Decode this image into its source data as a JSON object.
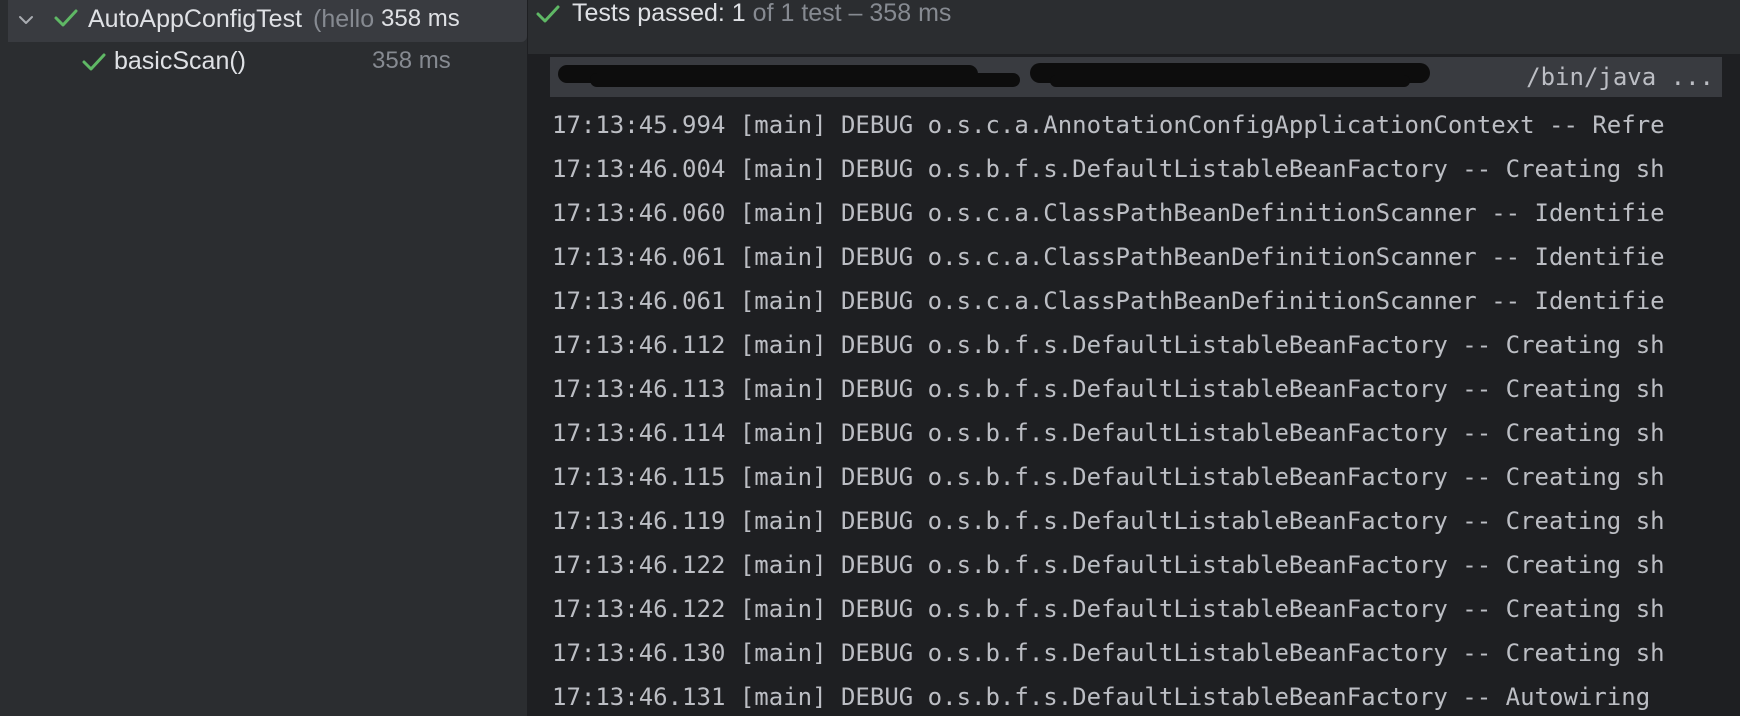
{
  "tree": {
    "root": {
      "label": "AutoAppConfigTest",
      "hint": "(hello",
      "time": "358 ms"
    },
    "child": {
      "label": "basicScan()",
      "time": "358 ms"
    }
  },
  "status": {
    "passed_label": "Tests passed: 1",
    "detail": "of 1 test – 358 ms"
  },
  "command": {
    "visible_text": "/bin/java ..."
  },
  "log": [
    "17:13:45.994 [main] DEBUG o.s.c.a.AnnotationConfigApplicationContext -- Refre",
    "17:13:46.004 [main] DEBUG o.s.b.f.s.DefaultListableBeanFactory -- Creating sh",
    "17:13:46.060 [main] DEBUG o.s.c.a.ClassPathBeanDefinitionScanner -- Identifie",
    "17:13:46.061 [main] DEBUG o.s.c.a.ClassPathBeanDefinitionScanner -- Identifie",
    "17:13:46.061 [main] DEBUG o.s.c.a.ClassPathBeanDefinitionScanner -- Identifie",
    "17:13:46.112 [main] DEBUG o.s.b.f.s.DefaultListableBeanFactory -- Creating sh",
    "17:13:46.113 [main] DEBUG o.s.b.f.s.DefaultListableBeanFactory -- Creating sh",
    "17:13:46.114 [main] DEBUG o.s.b.f.s.DefaultListableBeanFactory -- Creating sh",
    "17:13:46.115 [main] DEBUG o.s.b.f.s.DefaultListableBeanFactory -- Creating sh",
    "17:13:46.119 [main] DEBUG o.s.b.f.s.DefaultListableBeanFactory -- Creating sh",
    "17:13:46.122 [main] DEBUG o.s.b.f.s.DefaultListableBeanFactory -- Creating sh",
    "17:13:46.122 [main] DEBUG o.s.b.f.s.DefaultListableBeanFactory -- Creating sh",
    "17:13:46.130 [main] DEBUG o.s.b.f.s.DefaultListableBeanFactory -- Creating sh",
    "17:13:46.131 [main] DEBUG o.s.b.f.s.DefaultListableBeanFactory -- Autowiring"
  ],
  "icons": {
    "expand": "chevron-down-icon",
    "passed": "checkmark-icon"
  },
  "colors": {
    "pass_green": "#5fb865",
    "tree_bg": "#2b2d30",
    "console_bg": "#1e1f22",
    "selection_bg": "#393b40"
  }
}
